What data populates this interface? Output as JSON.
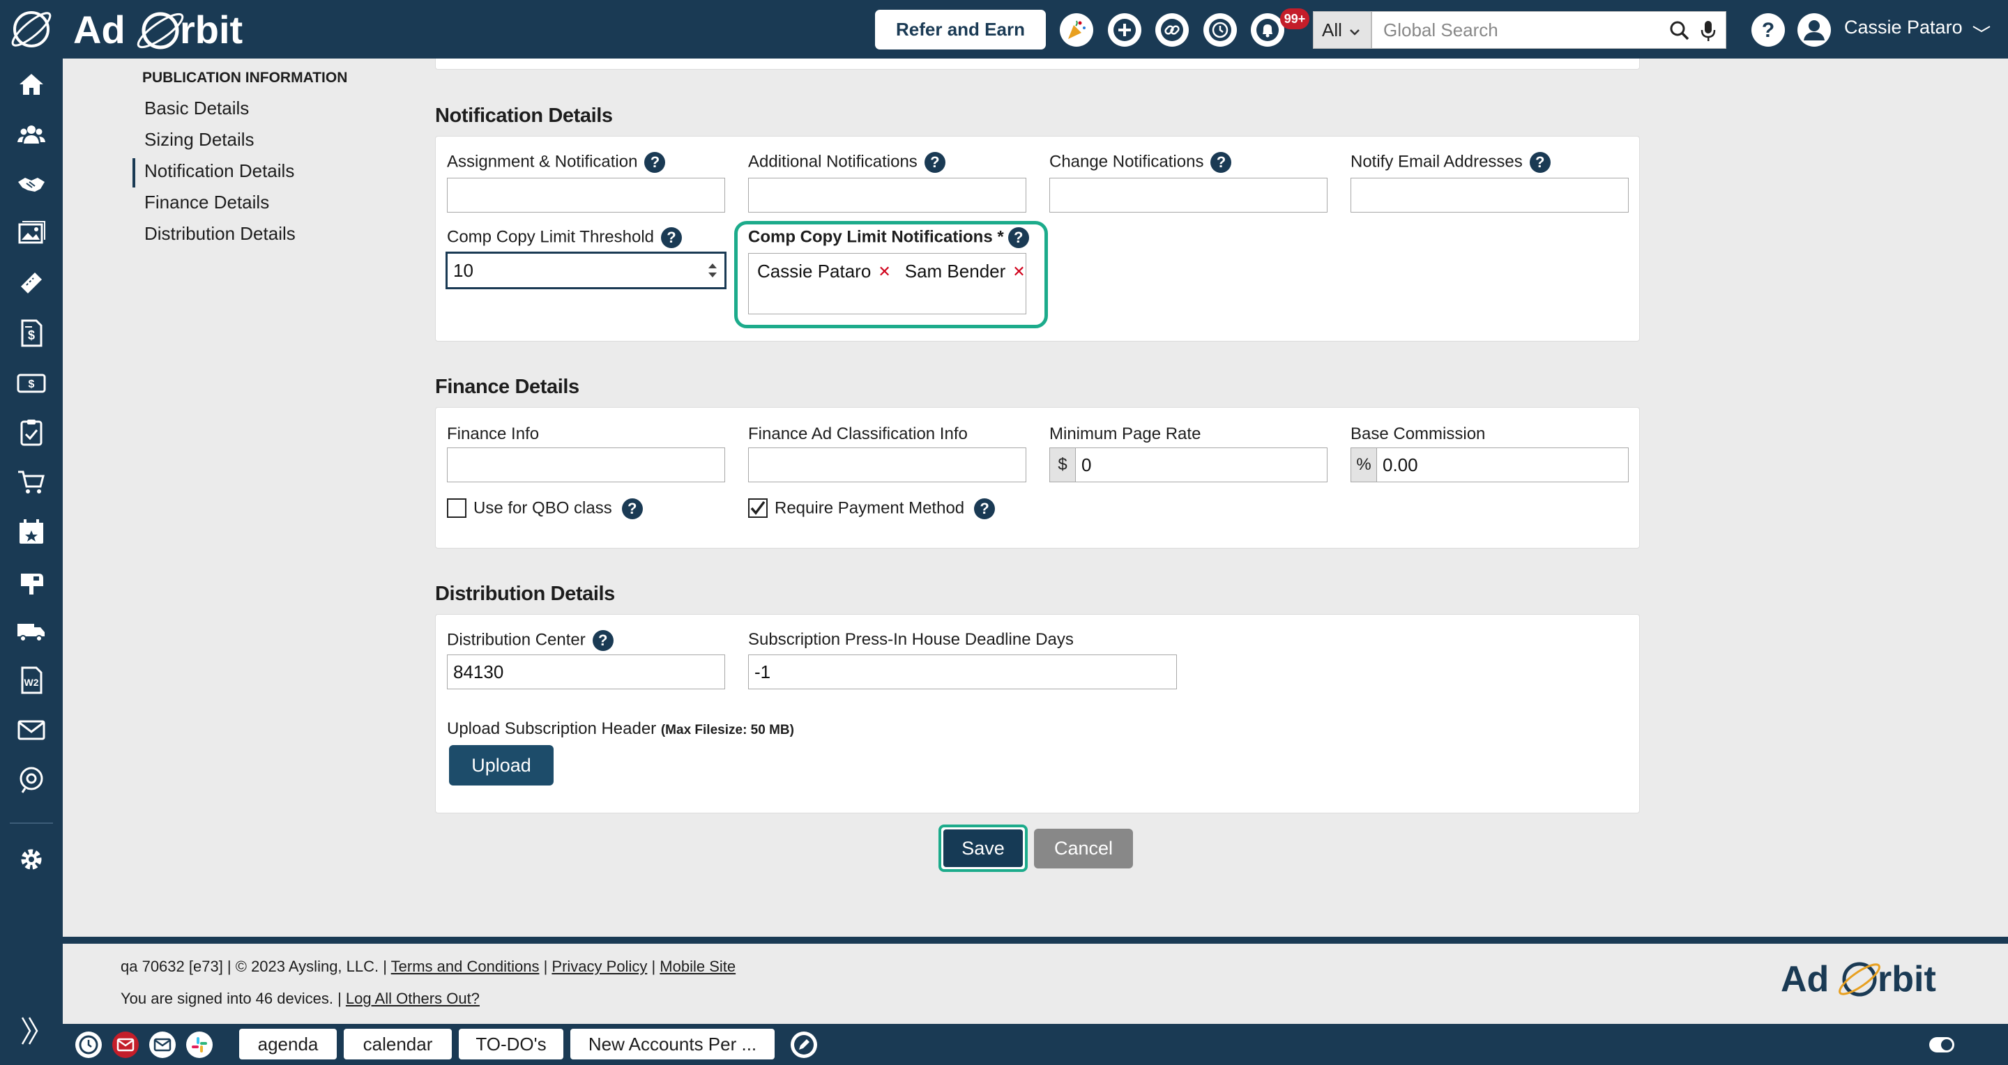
{
  "topbar": {
    "logo_text": "AdOrbit",
    "refer_label": "Refer and Earn",
    "notif_count": "99+",
    "search_scope": "All",
    "search_placeholder": "Global Search",
    "user_name": "Cassie Pataro"
  },
  "nav": {
    "heading": "PUBLICATION INFORMATION",
    "items": [
      "Basic Details",
      "Sizing Details",
      "Notification Details",
      "Finance Details",
      "Distribution Details"
    ],
    "active_index": 2
  },
  "notification": {
    "title": "Notification Details",
    "assignment_label": "Assignment & Notification",
    "additional_label": "Additional Notifications",
    "change_label": "Change Notifications",
    "notify_email_label": "Notify Email Addresses",
    "threshold_label": "Comp Copy Limit Threshold",
    "threshold_value": "10",
    "limit_notif_label": "Comp Copy Limit Notifications *",
    "limit_notif_tags": [
      "Cassie Pataro",
      "Sam Bender"
    ]
  },
  "finance": {
    "title": "Finance Details",
    "info_label": "Finance Info",
    "ad_class_label": "Finance Ad Classification Info",
    "min_rate_label": "Minimum Page Rate",
    "min_rate_prefix": "$",
    "min_rate_value": "0",
    "commission_label": "Base Commission",
    "commission_prefix": "%",
    "commission_value": "0.00",
    "qbo_label": "Use for QBO class",
    "qbo_checked": false,
    "payment_label": "Require Payment Method",
    "payment_checked": true
  },
  "distribution": {
    "title": "Distribution Details",
    "center_label": "Distribution Center",
    "center_value": "84130",
    "deadline_label": "Subscription Press-In House Deadline Days",
    "deadline_value": "-1",
    "upload_label": "Upload Subscription Header",
    "upload_note": "(Max Filesize: 50 MB)",
    "upload_button": "Upload"
  },
  "actions": {
    "save": "Save",
    "cancel": "Cancel"
  },
  "footer": {
    "line1_prefix": "qa 70632 [e73] | © 2023 Aysling, LLC. |",
    "terms": "Terms and Conditions",
    "privacy": "Privacy Policy",
    "mobile": "Mobile Site",
    "line2_prefix": "You are signed into 46 devices. |",
    "logout_others": "Log All Others Out?",
    "logo_text": "AdOrbit"
  },
  "bottombar": {
    "tabs": [
      "agenda",
      "calendar",
      "TO-DO's",
      "New Accounts Per ..."
    ]
  },
  "colors": {
    "brand_navy": "#1a3a54",
    "highlight_teal": "#1cab8b",
    "remove_red": "#d0021b",
    "badge_red": "#c41e2a"
  }
}
